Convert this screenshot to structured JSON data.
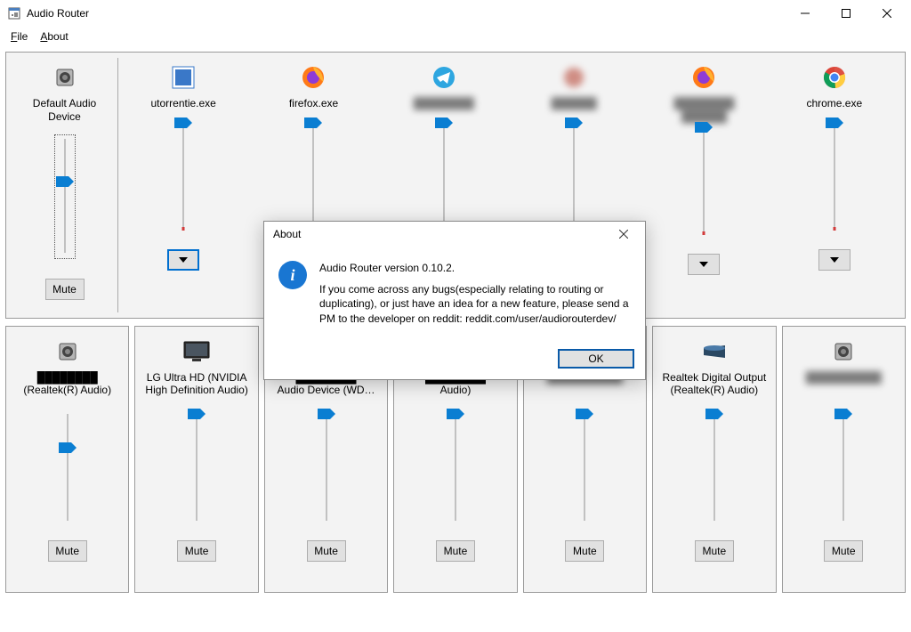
{
  "window": {
    "title": "Audio Router"
  },
  "menu": {
    "file": "File",
    "about": "About"
  },
  "top": {
    "default_label": "Default Audio Device",
    "mute_label": "Mute",
    "apps": [
      {
        "label": "utorrentie.exe",
        "icon": "utorrent",
        "blur": false
      },
      {
        "label": "firefox.exe",
        "icon": "firefox",
        "blur": false
      },
      {
        "label": "",
        "icon": "telegram",
        "blur": false,
        "label_blur": true
      },
      {
        "label": "",
        "icon": "generic-red",
        "blur": true,
        "label_blur": true
      },
      {
        "label": "",
        "icon": "firefox",
        "blur": false,
        "label_blur": true
      },
      {
        "label": "chrome.exe",
        "icon": "chrome",
        "blur": false
      }
    ]
  },
  "devices": [
    {
      "label1": "",
      "label2": "(Realtek(R) Audio)",
      "icon": "speaker",
      "blur_label1": true
    },
    {
      "label1": "LG Ultra HD (NVIDIA High Definition Audio)",
      "label2": "",
      "icon": "monitor"
    },
    {
      "label1": "",
      "label2": "Audio Device (WD…",
      "icon": "generic",
      "blur_label1": true
    },
    {
      "label1": "",
      "label2": "Audio)",
      "icon": "generic",
      "blur_label1": true
    },
    {
      "label1": "",
      "label2": "",
      "icon": "generic",
      "blur_label1": true
    },
    {
      "label1": "Realtek Digital Output (Realtek(R) Audio)",
      "label2": "",
      "icon": "digital"
    },
    {
      "label1": "",
      "label2": "",
      "icon": "speaker",
      "blur_label1": true
    }
  ],
  "mute": "Mute",
  "about_dialog": {
    "title": "About",
    "line1": "Audio Router version 0.10.2.",
    "line2": "If you come across any bugs(especially relating to routing or duplicating), or just have an idea for a new feature, please send a PM to the developer on reddit: reddit.com/user/audiorouterdev/",
    "ok": "OK"
  }
}
